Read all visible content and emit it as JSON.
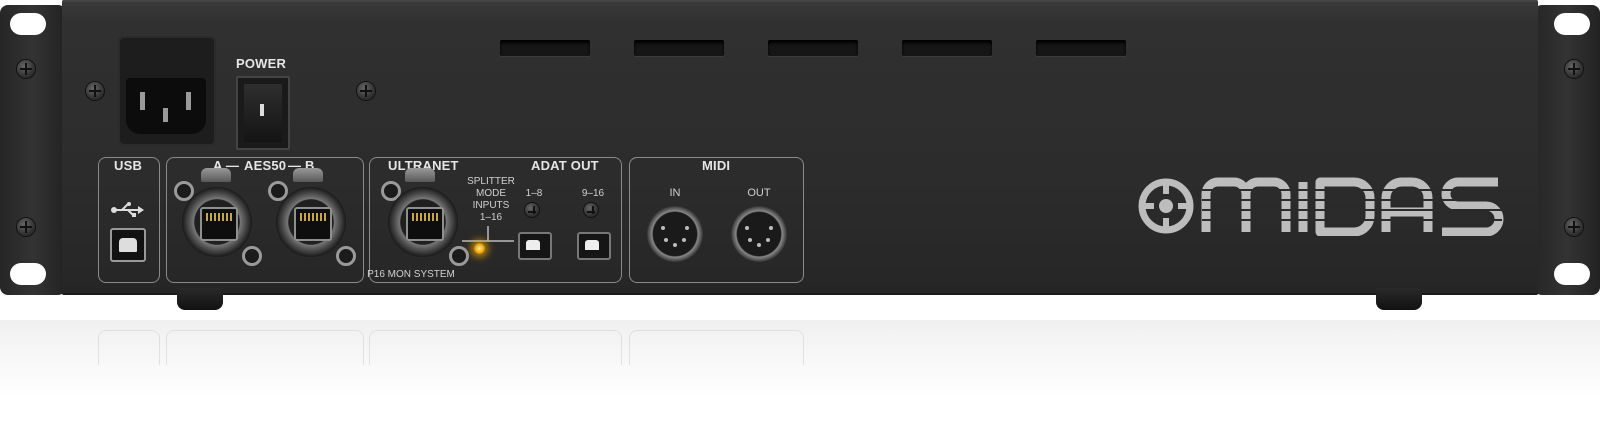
{
  "device": {
    "power_label": "POWER",
    "usb_label": "USB",
    "aes50": {
      "a_label": "A —",
      "center_label": "AES50",
      "b_label": "— B"
    },
    "ultranet_label": "ULTRANET",
    "splitter_mode_text": [
      "SPLITTER",
      "MODE",
      "INPUTS",
      "1–16"
    ],
    "p16_label": "P16 MON SYSTEM",
    "adat_out": {
      "title": "ADAT OUT",
      "port1_label": "1–8",
      "port2_label": "9–16"
    },
    "midi": {
      "title": "MIDI",
      "in_label": "IN",
      "out_label": "OUT"
    },
    "brand": "MIDAS"
  }
}
